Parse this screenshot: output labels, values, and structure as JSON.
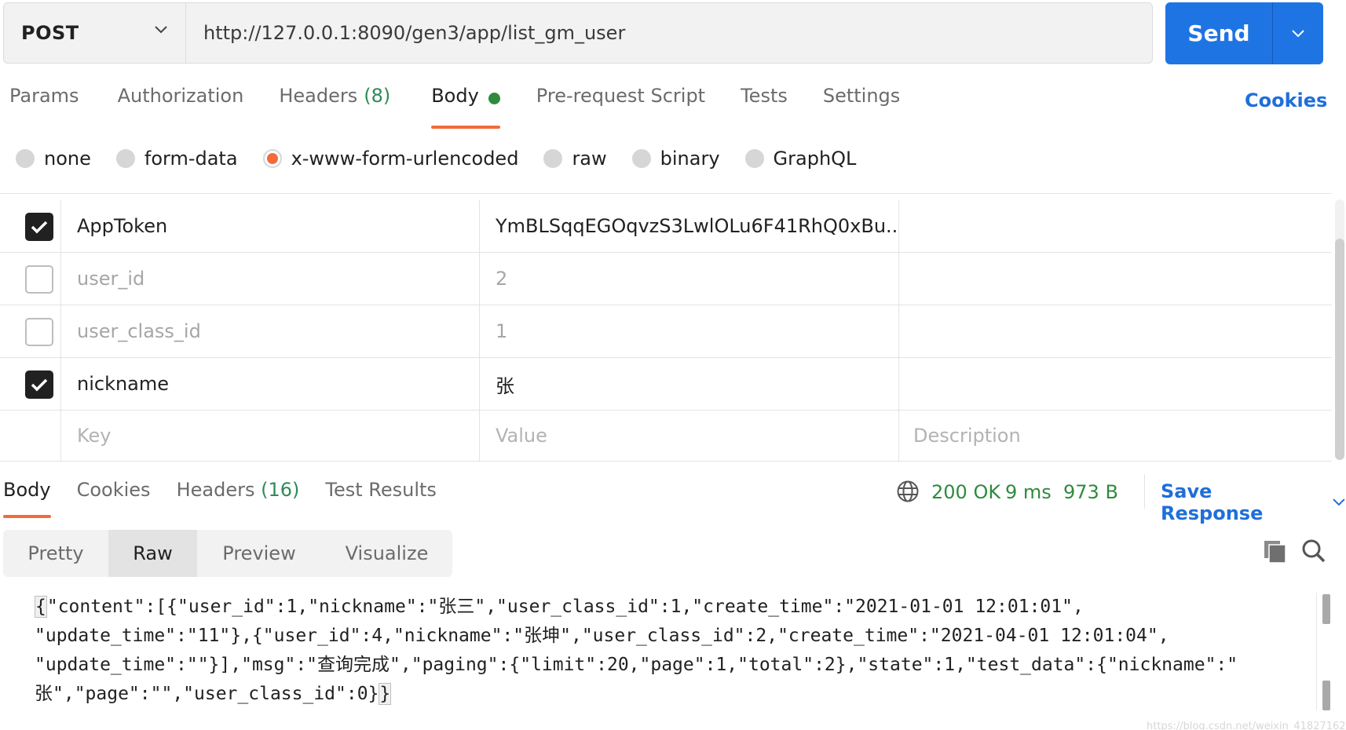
{
  "request": {
    "method": "POST",
    "url": "http://127.0.0.1:8090/gen3/app/list_gm_user",
    "send_label": "Send"
  },
  "req_tabs": [
    {
      "label": "Params",
      "count": ""
    },
    {
      "label": "Authorization",
      "count": ""
    },
    {
      "label": "Headers",
      "count": "(8)"
    },
    {
      "label": "Body",
      "count": "",
      "active": true
    },
    {
      "label": "Pre-request Script",
      "count": ""
    },
    {
      "label": "Tests",
      "count": ""
    },
    {
      "label": "Settings",
      "count": ""
    }
  ],
  "cookies_link": "Cookies",
  "body_types": [
    "none",
    "form-data",
    "x-www-form-urlencoded",
    "raw",
    "binary",
    "GraphQL"
  ],
  "body_type_selected": "x-www-form-urlencoded",
  "params": [
    {
      "checked": true,
      "key": "AppToken",
      "value": "YmBLSqqEGOqvzS3LwlOLu6F41RhQ0xBu..."
    },
    {
      "checked": false,
      "key": "user_id",
      "value": "2"
    },
    {
      "checked": false,
      "key": "user_class_id",
      "value": "1"
    },
    {
      "checked": true,
      "key": "nickname",
      "value": "张"
    }
  ],
  "placeholders": {
    "key": "Key",
    "value": "Value",
    "description": "Description"
  },
  "resp_tabs": [
    {
      "label": "Body",
      "count": "",
      "active": true
    },
    {
      "label": "Cookies",
      "count": ""
    },
    {
      "label": "Headers",
      "count": "(16)"
    },
    {
      "label": "Test Results",
      "count": ""
    }
  ],
  "status": {
    "code": "200 OK",
    "time": "9 ms",
    "size": "973 B"
  },
  "save_response": "Save Response",
  "formats": [
    "Pretty",
    "Raw",
    "Preview",
    "Visualize"
  ],
  "format_selected": "Raw",
  "raw_lines": [
    "\"content\":[{\"user_id\":1,\"nickname\":\"张三\",\"user_class_id\":1,\"create_time\":\"2021-01-01 12:01:01\",",
    "\"update_time\":\"11\"},{\"user_id\":4,\"nickname\":\"张坤\",\"user_class_id\":2,\"create_time\":\"2021-04-01 12:01:04\",",
    "\"update_time\":\"\"}],\"msg\":\"查询完成\",\"paging\":{\"limit\":20,\"page\":1,\"total\":2},\"state\":1,\"test_data\":{\"nickname\":\"",
    "张\",\"page\":\"\",\"user_class_id\":0}"
  ],
  "watermark": "https://blog.csdn.net/weixin_41827162",
  "colors": {
    "accent": "#f26b3a",
    "send": "#1f74e4",
    "link": "#1f6fd8",
    "success": "#2e8b3e"
  },
  "icons": {
    "method_dropdown": "chevron-down-icon",
    "send_dropdown": "chevron-down-icon",
    "globe": "globe-icon",
    "copy": "copy-icon",
    "search": "search-icon"
  }
}
